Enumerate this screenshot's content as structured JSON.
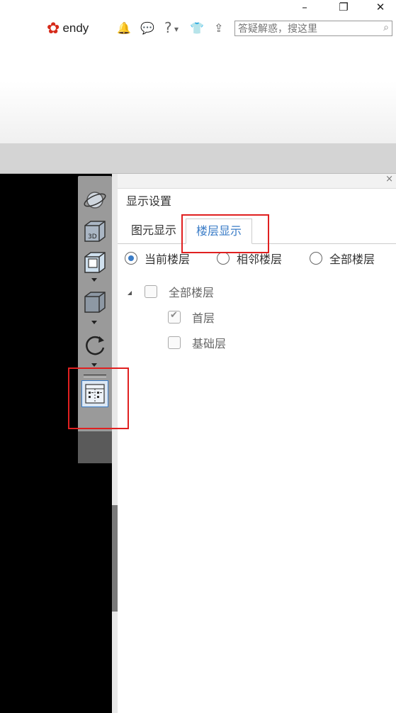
{
  "window": {
    "minimize_glyph": "–",
    "restore_glyph": "❐",
    "close_glyph": "✕"
  },
  "user": {
    "name": "endy",
    "avatar_glyph": "✿"
  },
  "toolbar_icons": [
    "bell-icon",
    "chat-icon",
    "help-icon",
    "shirt-icon",
    "upload-icon"
  ],
  "toolbar_glyphs": {
    "bell": "🔔",
    "chat": "💬",
    "help": "?",
    "help_arrow": "▾",
    "shirt": "👕",
    "upload": "⇪"
  },
  "search": {
    "placeholder": "答疑解惑，搜这里",
    "icon": "⌕"
  },
  "panel": {
    "title": "显示设置",
    "close_glyph": "×",
    "tabs": [
      {
        "label": "图元显示",
        "active": false
      },
      {
        "label": "楼层显示",
        "active": true
      }
    ],
    "radios": [
      {
        "label": "当前楼层",
        "selected": true
      },
      {
        "label": "相邻楼层",
        "selected": false
      },
      {
        "label": "全部楼层",
        "selected": false
      }
    ],
    "tree": {
      "root": {
        "label": "全部楼层",
        "checked": false
      },
      "children": [
        {
          "label": "首层",
          "checked": true
        },
        {
          "label": "基础层",
          "checked": false
        }
      ]
    }
  },
  "side_tools": [
    "orbit-icon",
    "view-3d-icon",
    "wireframe-cube-icon",
    "solid-cube-icon",
    "rotate-icon",
    "floor-display-icon"
  ],
  "colors": {
    "accent": "#3a7cc7",
    "highlight": "#e02020",
    "viewport": "#000000"
  }
}
